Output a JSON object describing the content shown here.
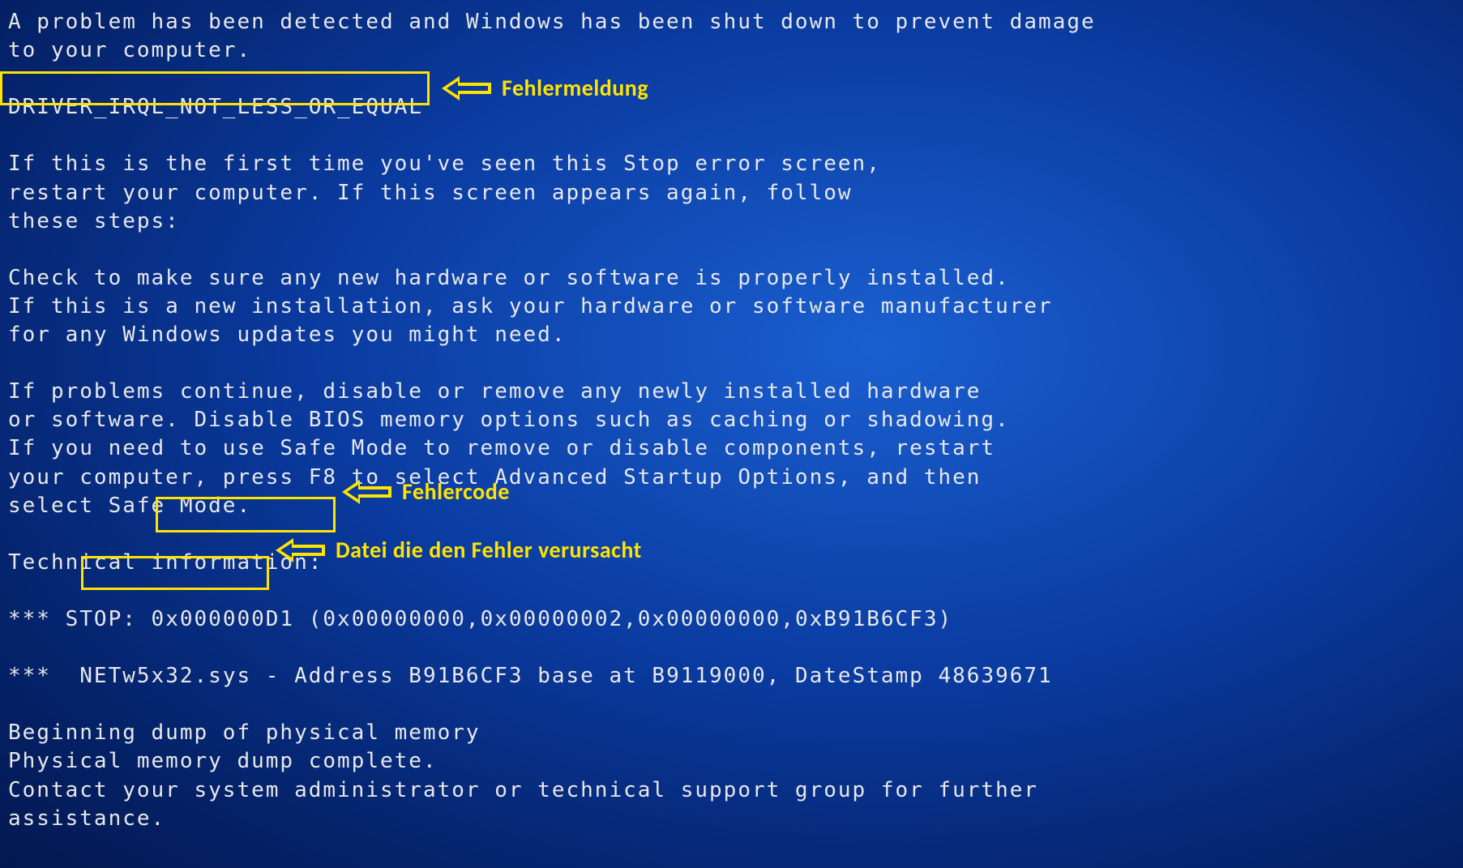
{
  "bsod": {
    "intro1": "A problem has been detected and Windows has been shut down to prevent damage",
    "intro2": "to your computer.",
    "error_name": "DRIVER_IRQL_NOT_LESS_OR_EQUAL",
    "p1_l1": "If this is the first time you've seen this Stop error screen,",
    "p1_l2": "restart your computer. If this screen appears again, follow",
    "p1_l3": "these steps:",
    "p2_l1": "Check to make sure any new hardware or software is properly installed.",
    "p2_l2": "If this is a new installation, ask your hardware or software manufacturer",
    "p2_l3": "for any Windows updates you might need.",
    "p3_l1": "If problems continue, disable or remove any newly installed hardware",
    "p3_l2": "or software. Disable BIOS memory options such as caching or shadowing.",
    "p3_l3": "If you need to use Safe Mode to remove or disable components, restart",
    "p3_l4": "your computer, press F8 to select Advanced Startup Options, and then",
    "p3_l5": "select Safe Mode.",
    "tech_header": "Technical information:",
    "stop_prefix": "*** STOP: ",
    "stop_code": "0x000000D1",
    "stop_params": " (0x00000000,0x00000002,0x00000000,0xB91B6CF3)",
    "file_prefix": "***  ",
    "file_name": "NETw5x32.sys",
    "file_suffix": " - Address B91B6CF3 base at B9119000, DateStamp 48639671",
    "dump_l1": "Beginning dump of physical memory",
    "dump_l2": "Physical memory dump complete.",
    "dump_l3": "Contact your system administrator or technical support group for further",
    "dump_l4": "assistance."
  },
  "annotations": {
    "label_error_message": "Fehlermeldung",
    "label_error_code": "Fehlercode",
    "label_file_cause": "Datei die den Fehler verursacht"
  }
}
